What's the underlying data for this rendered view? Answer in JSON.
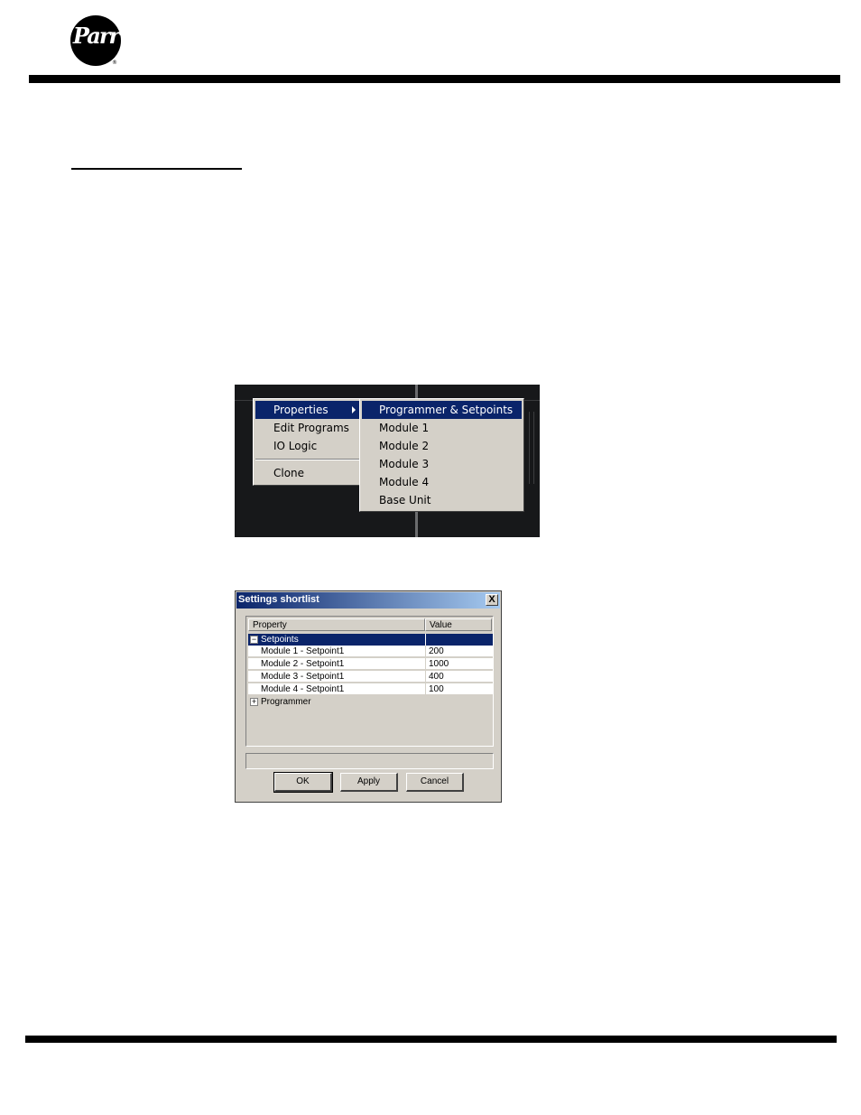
{
  "logo": {
    "text": "Parr",
    "registered": "®"
  },
  "context_menu": {
    "main_items": [
      "Properties",
      "Edit Programs",
      "IO Logic",
      "Clone"
    ],
    "submenu_items": [
      "Programmer & Setpoints",
      "Module 1",
      "Module 2",
      "Module 3",
      "Module 4",
      "Base Unit"
    ]
  },
  "dialog": {
    "title": "Settings shortlist",
    "close_label": "X",
    "columns": {
      "property": "Property",
      "value": "Value"
    },
    "group_setpoints": {
      "label": "Setpoints",
      "toggle": "−"
    },
    "rows": [
      {
        "property": "Module 1 - Setpoint1",
        "value": "200"
      },
      {
        "property": "Module 2 - Setpoint1",
        "value": "1000"
      },
      {
        "property": "Module 3 - Setpoint1",
        "value": "400"
      },
      {
        "property": "Module 4 - Setpoint1",
        "value": "100"
      }
    ],
    "group_programmer": {
      "label": "Programmer",
      "toggle": "+"
    },
    "buttons": {
      "ok": "OK",
      "apply": "Apply",
      "cancel": "Cancel"
    }
  },
  "colors": {
    "menu_highlight": "#0a246a",
    "window_face": "#d4d0c8",
    "rule": "#000000"
  }
}
